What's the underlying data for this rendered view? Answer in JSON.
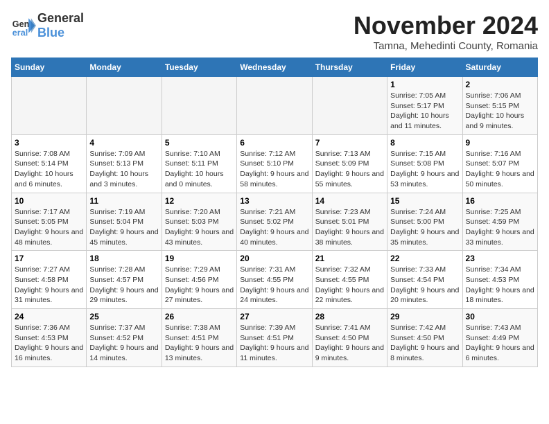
{
  "header": {
    "logo_general": "General",
    "logo_blue": "Blue",
    "month": "November 2024",
    "location": "Tamna, Mehedinti County, Romania"
  },
  "weekdays": [
    "Sunday",
    "Monday",
    "Tuesday",
    "Wednesday",
    "Thursday",
    "Friday",
    "Saturday"
  ],
  "weeks": [
    [
      {
        "day": "",
        "info": ""
      },
      {
        "day": "",
        "info": ""
      },
      {
        "day": "",
        "info": ""
      },
      {
        "day": "",
        "info": ""
      },
      {
        "day": "",
        "info": ""
      },
      {
        "day": "1",
        "info": "Sunrise: 7:05 AM\nSunset: 5:17 PM\nDaylight: 10 hours and 11 minutes."
      },
      {
        "day": "2",
        "info": "Sunrise: 7:06 AM\nSunset: 5:15 PM\nDaylight: 10 hours and 9 minutes."
      }
    ],
    [
      {
        "day": "3",
        "info": "Sunrise: 7:08 AM\nSunset: 5:14 PM\nDaylight: 10 hours and 6 minutes."
      },
      {
        "day": "4",
        "info": "Sunrise: 7:09 AM\nSunset: 5:13 PM\nDaylight: 10 hours and 3 minutes."
      },
      {
        "day": "5",
        "info": "Sunrise: 7:10 AM\nSunset: 5:11 PM\nDaylight: 10 hours and 0 minutes."
      },
      {
        "day": "6",
        "info": "Sunrise: 7:12 AM\nSunset: 5:10 PM\nDaylight: 9 hours and 58 minutes."
      },
      {
        "day": "7",
        "info": "Sunrise: 7:13 AM\nSunset: 5:09 PM\nDaylight: 9 hours and 55 minutes."
      },
      {
        "day": "8",
        "info": "Sunrise: 7:15 AM\nSunset: 5:08 PM\nDaylight: 9 hours and 53 minutes."
      },
      {
        "day": "9",
        "info": "Sunrise: 7:16 AM\nSunset: 5:07 PM\nDaylight: 9 hours and 50 minutes."
      }
    ],
    [
      {
        "day": "10",
        "info": "Sunrise: 7:17 AM\nSunset: 5:05 PM\nDaylight: 9 hours and 48 minutes."
      },
      {
        "day": "11",
        "info": "Sunrise: 7:19 AM\nSunset: 5:04 PM\nDaylight: 9 hours and 45 minutes."
      },
      {
        "day": "12",
        "info": "Sunrise: 7:20 AM\nSunset: 5:03 PM\nDaylight: 9 hours and 43 minutes."
      },
      {
        "day": "13",
        "info": "Sunrise: 7:21 AM\nSunset: 5:02 PM\nDaylight: 9 hours and 40 minutes."
      },
      {
        "day": "14",
        "info": "Sunrise: 7:23 AM\nSunset: 5:01 PM\nDaylight: 9 hours and 38 minutes."
      },
      {
        "day": "15",
        "info": "Sunrise: 7:24 AM\nSunset: 5:00 PM\nDaylight: 9 hours and 35 minutes."
      },
      {
        "day": "16",
        "info": "Sunrise: 7:25 AM\nSunset: 4:59 PM\nDaylight: 9 hours and 33 minutes."
      }
    ],
    [
      {
        "day": "17",
        "info": "Sunrise: 7:27 AM\nSunset: 4:58 PM\nDaylight: 9 hours and 31 minutes."
      },
      {
        "day": "18",
        "info": "Sunrise: 7:28 AM\nSunset: 4:57 PM\nDaylight: 9 hours and 29 minutes."
      },
      {
        "day": "19",
        "info": "Sunrise: 7:29 AM\nSunset: 4:56 PM\nDaylight: 9 hours and 27 minutes."
      },
      {
        "day": "20",
        "info": "Sunrise: 7:31 AM\nSunset: 4:55 PM\nDaylight: 9 hours and 24 minutes."
      },
      {
        "day": "21",
        "info": "Sunrise: 7:32 AM\nSunset: 4:55 PM\nDaylight: 9 hours and 22 minutes."
      },
      {
        "day": "22",
        "info": "Sunrise: 7:33 AM\nSunset: 4:54 PM\nDaylight: 9 hours and 20 minutes."
      },
      {
        "day": "23",
        "info": "Sunrise: 7:34 AM\nSunset: 4:53 PM\nDaylight: 9 hours and 18 minutes."
      }
    ],
    [
      {
        "day": "24",
        "info": "Sunrise: 7:36 AM\nSunset: 4:53 PM\nDaylight: 9 hours and 16 minutes."
      },
      {
        "day": "25",
        "info": "Sunrise: 7:37 AM\nSunset: 4:52 PM\nDaylight: 9 hours and 14 minutes."
      },
      {
        "day": "26",
        "info": "Sunrise: 7:38 AM\nSunset: 4:51 PM\nDaylight: 9 hours and 13 minutes."
      },
      {
        "day": "27",
        "info": "Sunrise: 7:39 AM\nSunset: 4:51 PM\nDaylight: 9 hours and 11 minutes."
      },
      {
        "day": "28",
        "info": "Sunrise: 7:41 AM\nSunset: 4:50 PM\nDaylight: 9 hours and 9 minutes."
      },
      {
        "day": "29",
        "info": "Sunrise: 7:42 AM\nSunset: 4:50 PM\nDaylight: 9 hours and 8 minutes."
      },
      {
        "day": "30",
        "info": "Sunrise: 7:43 AM\nSunset: 4:49 PM\nDaylight: 9 hours and 6 minutes."
      }
    ]
  ]
}
